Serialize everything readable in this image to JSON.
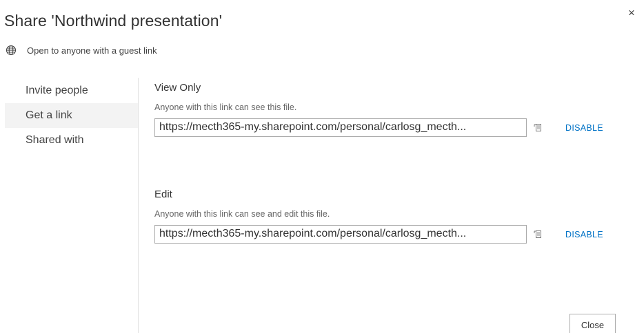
{
  "dialog": {
    "title": "Share 'Northwind presentation'",
    "close_glyph": "×",
    "guest_text": "Open to anyone with a guest link",
    "guest_icon": "globe-icon"
  },
  "nav": {
    "items": [
      {
        "label": "Invite people",
        "selected": false
      },
      {
        "label": "Get a link",
        "selected": true
      },
      {
        "label": "Shared with",
        "selected": false
      }
    ]
  },
  "sections": {
    "view": {
      "title": "View Only",
      "description": "Anyone with this link can see this file.",
      "link": "https://mecth365-my.sharepoint.com/personal/carlosg_mecth...",
      "disable_label": "DISABLE",
      "copy_icon": "copy-link-icon"
    },
    "edit": {
      "title": "Edit",
      "description": "Anyone with this link can see and edit this file.",
      "link": "https://mecth365-my.sharepoint.com/personal/carlosg_mecth...",
      "disable_label": "DISABLE",
      "copy_icon": "copy-link-icon"
    }
  },
  "footer": {
    "close_label": "Close"
  },
  "colors": {
    "accent": "#0072c6",
    "selected_nav_bg": "#f3f3f3",
    "border": "#ababab"
  }
}
